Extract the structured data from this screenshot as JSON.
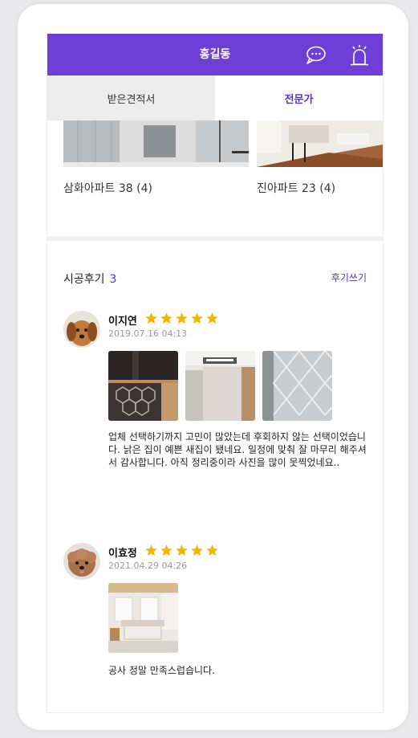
{
  "header": {
    "title": "홍길동",
    "chat_icon": "chat-bubble-icon",
    "bell_icon": "alarm-bell-icon"
  },
  "tabs": [
    {
      "label": "받은견적서",
      "active": false
    },
    {
      "label": "전문가",
      "active": true
    }
  ],
  "portfolio": [
    {
      "caption": "삼화아파트 38 (4)"
    },
    {
      "caption": "진아파트 23 (4)"
    }
  ],
  "reviews_section": {
    "title": "시공후기",
    "count": "3",
    "write_label": "후기쓰기"
  },
  "reviews": [
    {
      "name": "이지연",
      "rating": 5,
      "date": "2019.07.16 04:13",
      "text": "업체 선택하기까지 고민이 많았는데 후회하지 않는 선택이었습니다. 낡은 집이 예쁜 새집이 됐네요. 일정에 맞춰 잘 마무리 해주셔서 감사합니다. 아직 정리중이라 사진을 많이 못찍었네요.."
    },
    {
      "name": "이효정",
      "rating": 5,
      "date": "2021.04.29 04:26",
      "text": "공사 정말 만족스럽습니다."
    }
  ],
  "colors": {
    "accent": "#6e3ed6",
    "star": "#f5b400"
  }
}
